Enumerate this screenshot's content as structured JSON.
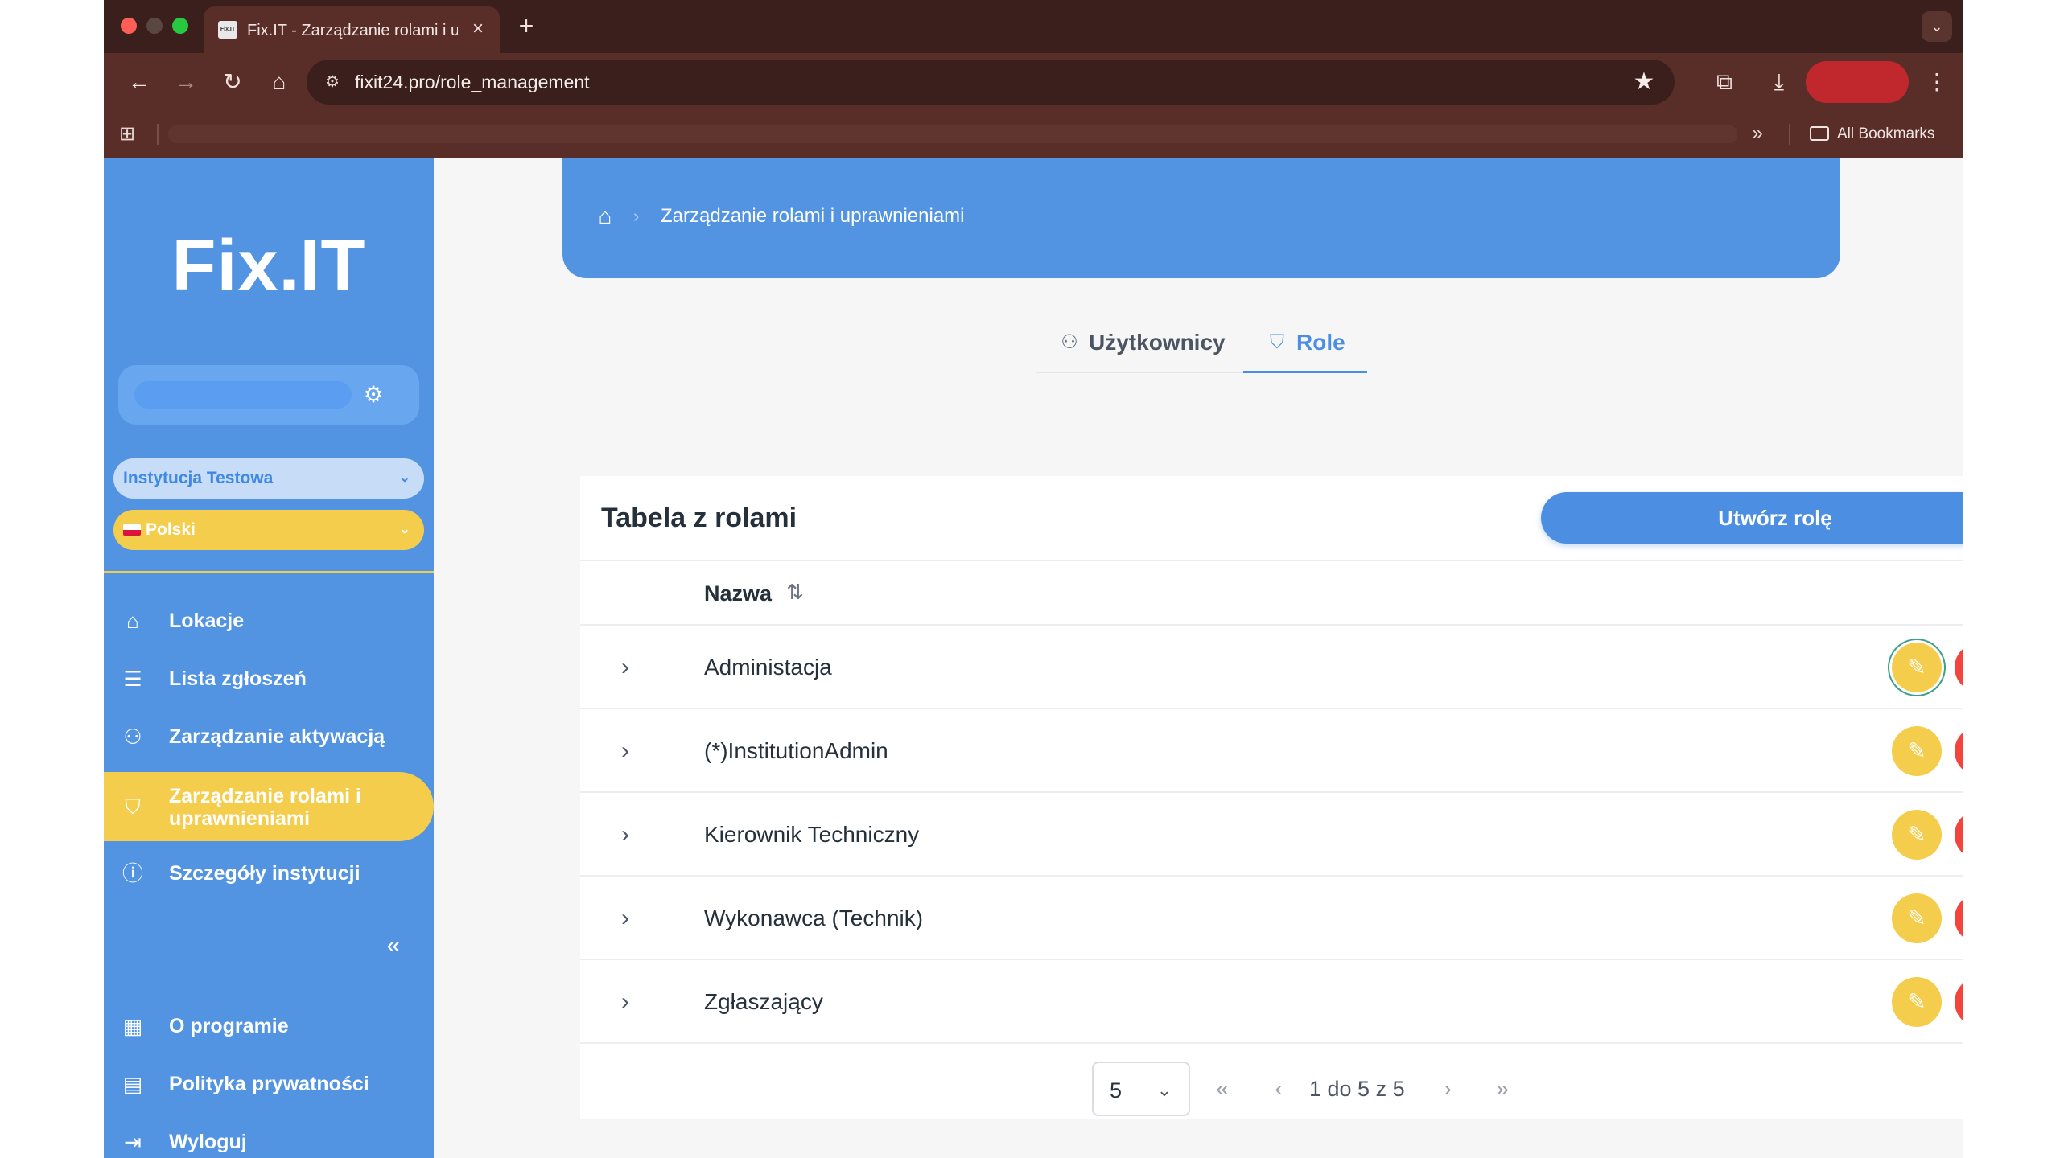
{
  "browser": {
    "tab_title": "Fix.IT - Zarządzanie rolami i u",
    "favicon_text": "Fix.IT",
    "url": "fixit24.pro/role_management",
    "all_bookmarks": "All Bookmarks"
  },
  "sidebar": {
    "logo": "Fix.IT",
    "institution": "Instytucja Testowa",
    "language": "Polski",
    "nav": [
      {
        "label": "Lokacje",
        "icon": "home-icon"
      },
      {
        "label": "Lista zgłoszeń",
        "icon": "list-icon"
      },
      {
        "label": "Zarządzanie aktywacją",
        "icon": "users-icon"
      },
      {
        "label": "Zarządzanie rolami i uprawnieniami",
        "icon": "shield-icon",
        "active": true
      },
      {
        "label": "Szczegóły instytucji",
        "icon": "info-icon"
      }
    ],
    "bottom_nav": [
      {
        "label": "O programie",
        "icon": "building-icon"
      },
      {
        "label": "Polityka prywatności",
        "icon": "document-icon"
      },
      {
        "label": "Wyloguj",
        "icon": "logout-icon"
      }
    ]
  },
  "breadcrumb": {
    "current": "Zarządzanie rolami i uprawnieniami"
  },
  "tabs": [
    {
      "label": "Użytkownicy",
      "active": false
    },
    {
      "label": "Role",
      "active": true
    }
  ],
  "table": {
    "title": "Tabela z rolami",
    "create_label": "Utwórz rolę",
    "column_name": "Nazwa",
    "rows": [
      {
        "name": "Administacja"
      },
      {
        "name": "(*)InstitutionAdmin"
      },
      {
        "name": "Kierownik Techniczny"
      },
      {
        "name": "Wykonawca (Technik)"
      },
      {
        "name": "Zgłaszający"
      }
    ]
  },
  "pagination": {
    "page_size": "5",
    "range_text": "1 do 5 z 5"
  },
  "colors": {
    "primary_blue": "#5294e2",
    "accent_yellow": "#f5cd4c",
    "danger_red": "#f2453d"
  }
}
